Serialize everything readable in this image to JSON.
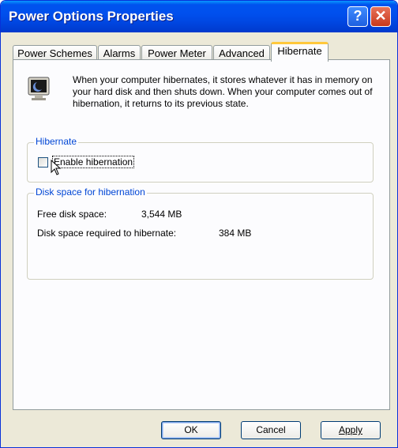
{
  "window": {
    "title": "Power Options Properties"
  },
  "titlebar": {
    "help_glyph": "?",
    "close_glyph": "✕"
  },
  "tabs": [
    {
      "label": "Power Schemes",
      "active": false
    },
    {
      "label": "Alarms",
      "active": false
    },
    {
      "label": "Power Meter",
      "active": false
    },
    {
      "label": "Advanced",
      "active": false
    },
    {
      "label": "Hibernate",
      "active": true
    }
  ],
  "description": "When your computer hibernates, it stores whatever it has in memory on your hard disk and then shuts down. When your computer comes out of hibernation, it returns to its previous state.",
  "hibernate_group": {
    "label": "Hibernate",
    "checkbox_label": "Enable hibernation",
    "checked": false
  },
  "disk_group": {
    "label": "Disk space for hibernation",
    "free_label": "Free disk space:",
    "free_value": "3,544 MB",
    "required_label": "Disk space required to hibernate:",
    "required_value": "384 MB"
  },
  "buttons": {
    "ok": "OK",
    "cancel": "Cancel",
    "apply": "Apply"
  },
  "icons": {
    "help": "help-icon",
    "close": "close-icon",
    "hibernate": "hibernate-monitor-icon",
    "cursor": "mouse-pointer-icon"
  }
}
